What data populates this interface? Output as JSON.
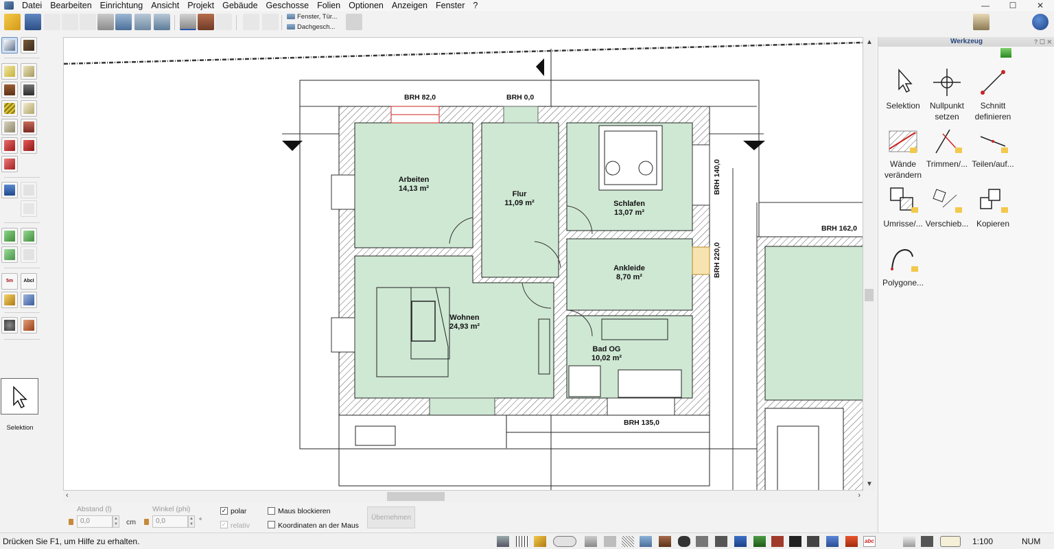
{
  "menu": [
    "Datei",
    "Bearbeiten",
    "Einrichtung",
    "Ansicht",
    "Projekt",
    "Gebäude",
    "Geschosse",
    "Folien",
    "Optionen",
    "Anzeigen",
    "Fenster",
    "?"
  ],
  "window_controls": {
    "minimize": "—",
    "maximize": "☐",
    "close": "✕"
  },
  "toolbar": {
    "dropdown_1": "Fenster, Tür...",
    "dropdown_2": "Dachgesch..."
  },
  "left_panel": {
    "active_tool_label": "Selektion",
    "text_icon_1": "5m",
    "text_icon_2": "AbcI"
  },
  "rooms": [
    {
      "name": "Arbeiten",
      "area": "14,13 m²"
    },
    {
      "name": "Flur",
      "area": "11,09 m²"
    },
    {
      "name": "Schlafen",
      "area": "13,07 m²"
    },
    {
      "name": "Ankleide",
      "area": "8,70 m²"
    },
    {
      "name": "Wohnen",
      "area": "24,93 m²"
    },
    {
      "name": "Bad OG",
      "area": "10,02 m²"
    }
  ],
  "brh_labels": {
    "top_left": "BRH 82,0",
    "top_mid": "BRH 0,0",
    "right_upper": "BRH 140,0",
    "right_lower": "BRH 220,0",
    "far_right": "BRH 162,0",
    "bottom": "BRH 135,0"
  },
  "right_panel": {
    "title": "Werkzeug",
    "title_controls": "? ☐ ✕",
    "tools": [
      {
        "label": "Selektion",
        "icon": "arrow-icon"
      },
      {
        "label": "Nullpunkt setzen",
        "icon": "crosshair-icon"
      },
      {
        "label": "Schnitt definieren",
        "icon": "section-icon"
      },
      {
        "label": "Wände verändern",
        "icon": "wall-edit-icon"
      },
      {
        "label": "Trimmen/...",
        "icon": "trim-icon"
      },
      {
        "label": "Teilen/auf...",
        "icon": "split-icon"
      },
      {
        "label": "Umrisse/...",
        "icon": "outline-icon"
      },
      {
        "label": "Verschieb...",
        "icon": "move-icon"
      },
      {
        "label": "Kopieren",
        "icon": "copy-icon"
      },
      {
        "label": "Polygone...",
        "icon": "polygon-icon"
      }
    ]
  },
  "input_bar": {
    "distance_label": "Abstand (l)",
    "distance_value": "0,0",
    "distance_unit": "cm",
    "angle_label": "Winkel (phi)",
    "angle_value": "0,0",
    "angle_unit": "°",
    "polar_label": "polar",
    "polar_checked": true,
    "relative_label": "relativ",
    "lock_mouse_label": "Maus blockieren",
    "coords_mouse_label": "Koordinaten an der Maus",
    "apply_label": "Übernehmen"
  },
  "status": {
    "help_text": "Drücken Sie F1, um Hilfe zu erhalten.",
    "scale": "1:100",
    "num": "NUM"
  },
  "colors": {
    "room_fill": "#cfe8d4",
    "wall_hatch": "#555555",
    "accent_title": "#26447a"
  }
}
